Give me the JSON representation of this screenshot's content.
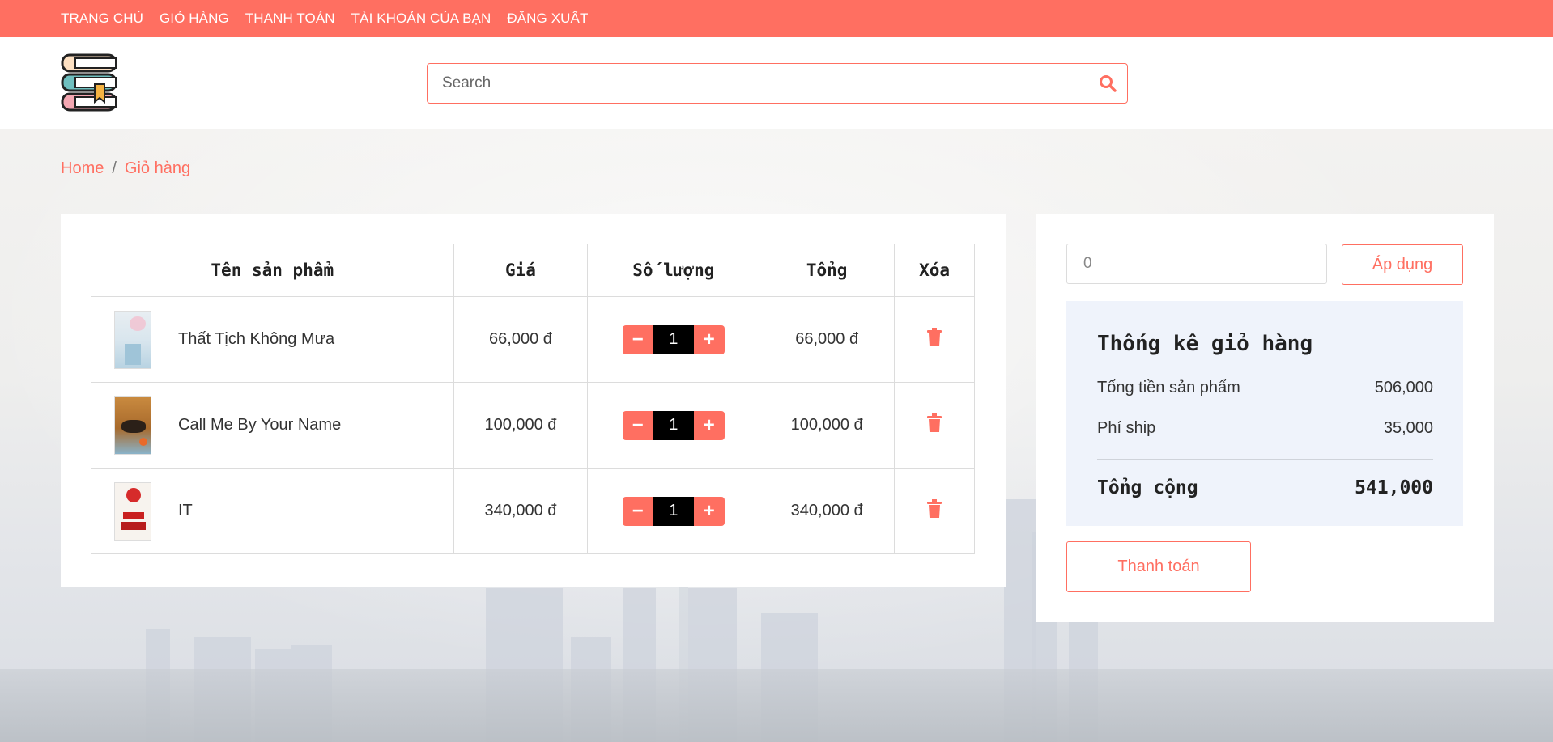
{
  "topnav": {
    "items": [
      {
        "label": "TRANG CHỦ"
      },
      {
        "label": "GIỎ HÀNG"
      },
      {
        "label": "THANH TOÁN"
      },
      {
        "label": "TÀI KHOẢN CỦA BẠN"
      },
      {
        "label": "ĐĂNG XUẤT"
      }
    ]
  },
  "search": {
    "placeholder": "Search",
    "icon": "search-icon"
  },
  "breadcrumb": {
    "home": "Home",
    "separator": "/",
    "current": "Giỏ hàng"
  },
  "cart": {
    "headers": {
      "name": "Tên sản phẩm",
      "price": "Giá",
      "qty": "Số lượng",
      "total": "Tổng",
      "delete": "Xóa"
    },
    "items": [
      {
        "name": "Thất Tịch Không Mưa",
        "price": "66,000 đ",
        "qty": "1",
        "total": "66,000 đ"
      },
      {
        "name": "Call Me By Your Name",
        "price": "100,000 đ",
        "qty": "1",
        "total": "100,000 đ"
      },
      {
        "name": "IT",
        "price": "340,000 đ",
        "qty": "1",
        "total": "340,000 đ"
      }
    ],
    "minus_label": "−",
    "plus_label": "+"
  },
  "summary": {
    "coupon_value": "0",
    "apply_label": "Áp dụng",
    "title": "Thống kê giỏ hàng",
    "subtotal_label": "Tổng tiền sản phẩm",
    "subtotal_value": "506,000",
    "ship_label": "Phí ship",
    "ship_value": "35,000",
    "total_label": "Tổng cộng",
    "total_value": "541,000",
    "checkout_label": "Thanh toán"
  },
  "colors": {
    "accent": "#ff6f61",
    "stats_bg": "#eff3fb",
    "qty_bg": "#000000"
  }
}
